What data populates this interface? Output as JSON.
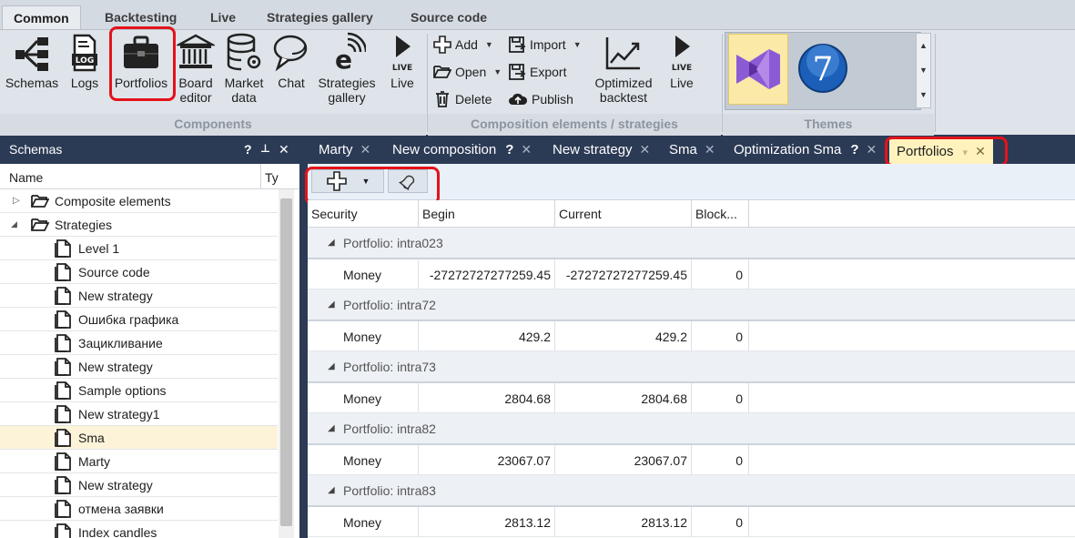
{
  "ribbon_tabs": [
    "Common",
    "Backtesting",
    "Live",
    "Strategies gallery",
    "Source code"
  ],
  "ribbon": {
    "components_buttons": [
      {
        "label": "Schemas",
        "icon": "schemas-icon"
      },
      {
        "label": "Logs",
        "icon": "logs-icon"
      },
      {
        "label": "Portfolios",
        "icon": "briefcase-icon"
      },
      {
        "label": "Board editor",
        "icon": "board-editor-icon"
      },
      {
        "label": "Market data",
        "icon": "database-icon"
      },
      {
        "label": "Chat",
        "icon": "chat-icon"
      },
      {
        "label": "Strategies gallery",
        "icon": "gallery-icon"
      },
      {
        "label": "Live",
        "icon": "play-icon",
        "badge": "LIVE"
      }
    ],
    "components_label": "Components",
    "composition": {
      "add": "Add",
      "open": "Open",
      "delete": "Delete",
      "import": "Import",
      "export": "Export",
      "publish": "Publish",
      "optimized_backtest": "Optimized backtest",
      "live": "Live",
      "live_badge": "LIVE"
    },
    "composition_label": "Composition elements / strategies",
    "themes_label": "Themes"
  },
  "schemas_panel": {
    "title": "Schemas",
    "controls": [
      "?",
      "↑",
      "✕"
    ],
    "column_name": "Name",
    "column_type": "Ty",
    "tree": [
      {
        "label": "Composite elements",
        "level": 0,
        "folder": true,
        "expanded": false
      },
      {
        "label": "Strategies",
        "level": 0,
        "folder": true,
        "expanded": true
      },
      {
        "label": "Level 1",
        "level": 1
      },
      {
        "label": "Source code",
        "level": 1
      },
      {
        "label": "New strategy",
        "level": 1
      },
      {
        "label": "Ошибка графика",
        "level": 1
      },
      {
        "label": "Зацикливание",
        "level": 1
      },
      {
        "label": "New strategy",
        "level": 1
      },
      {
        "label": "Sample options",
        "level": 1
      },
      {
        "label": "New strategy1",
        "level": 1
      },
      {
        "label": "Sma",
        "level": 1,
        "selected": true
      },
      {
        "label": "Marty",
        "level": 1
      },
      {
        "label": "New strategy",
        "level": 1
      },
      {
        "label": "отмена заявки",
        "level": 1
      },
      {
        "label": "Index candles",
        "level": 1
      }
    ]
  },
  "doc_tabs": [
    {
      "label": "Marty",
      "help": false
    },
    {
      "label": "New composition",
      "help": true
    },
    {
      "label": "New strategy",
      "help": false
    },
    {
      "label": "Sma",
      "help": false
    },
    {
      "label": "Optimization Sma",
      "help": true
    },
    {
      "label": "Portfolios",
      "help": false,
      "active": true
    }
  ],
  "grid": {
    "columns": [
      "Security",
      "Begin",
      "Current",
      "Block..."
    ],
    "groups": [
      {
        "title": "Portfolio: intra023",
        "rows": [
          {
            "security": "Money",
            "begin": "-27272727277259.45",
            "current": "-27272727277259.45",
            "blocked": "0"
          }
        ]
      },
      {
        "title": "Portfolio: intra72",
        "rows": [
          {
            "security": "Money",
            "begin": "429.2",
            "current": "429.2",
            "blocked": "0"
          }
        ]
      },
      {
        "title": "Portfolio: intra73",
        "rows": [
          {
            "security": "Money",
            "begin": "2804.68",
            "current": "2804.68",
            "blocked": "0"
          }
        ]
      },
      {
        "title": "Portfolio: intra82",
        "rows": [
          {
            "security": "Money",
            "begin": "23067.07",
            "current": "23067.07",
            "blocked": "0"
          }
        ]
      },
      {
        "title": "Portfolio: intra83",
        "rows": [
          {
            "security": "Money",
            "begin": "2813.12",
            "current": "2813.12",
            "blocked": "0"
          }
        ]
      }
    ]
  },
  "colors": {
    "accent_dark": "#2b3a55",
    "highlight_box": "#e3131b",
    "active_tab": "#fff2bd",
    "selected_row": "#fdf3d8"
  }
}
